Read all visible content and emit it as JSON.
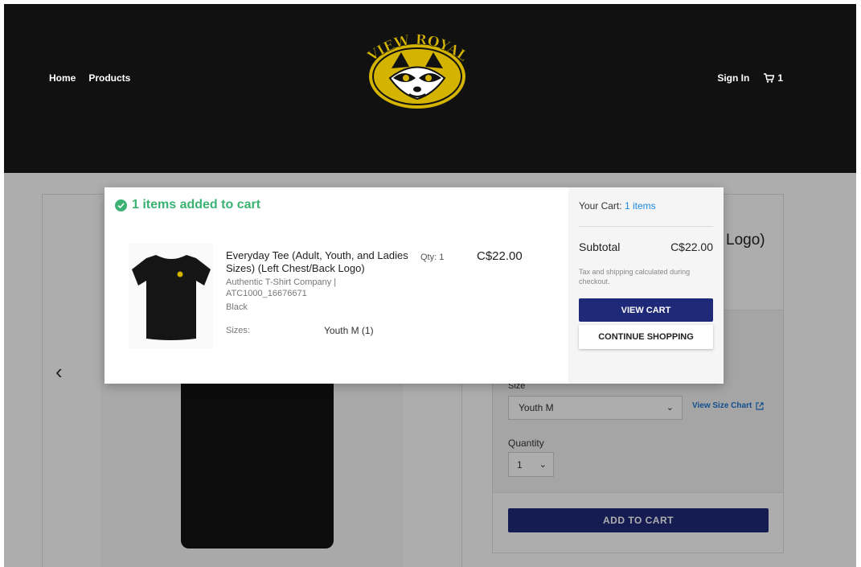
{
  "header": {
    "nav": {
      "home": "Home",
      "products": "Products"
    },
    "sign_in": "Sign In",
    "cart_count": "1",
    "logo_text": "VIEW ROYAL",
    "logo_color": "#d4b400"
  },
  "product": {
    "title_fragment": "Logo)",
    "size_label": "Size",
    "size_value": "Youth M",
    "size_chart_link": "View Size Chart",
    "quantity_label": "Quantity",
    "quantity_value": "1",
    "add_to_cart": "ADD TO CART"
  },
  "modal": {
    "added_title": "1 items added to cart",
    "item": {
      "name": "Everyday Tee (Adult, Youth, and Ladies Sizes) (Left Chest/Back Logo)",
      "vendor": "Authentic T-Shirt Company | ATC1000_16676671",
      "color": "Black",
      "sizes_label": "Sizes:",
      "sizes_value": "Youth M (1)",
      "qty": "Qty: 1",
      "price": "C$22.00"
    },
    "cart": {
      "label": "Your Cart:",
      "count": "1 items",
      "subtotal_label": "Subtotal",
      "subtotal_value": "C$22.00",
      "tax_note": "Tax and shipping calculated during checkout.",
      "view_cart": "VIEW CART",
      "continue_shopping": "CONTINUE SHOPPING"
    }
  },
  "colors": {
    "primary": "#1e2a78",
    "success": "#3bb273",
    "link": "#1e88e5",
    "header_bg": "#111111"
  }
}
